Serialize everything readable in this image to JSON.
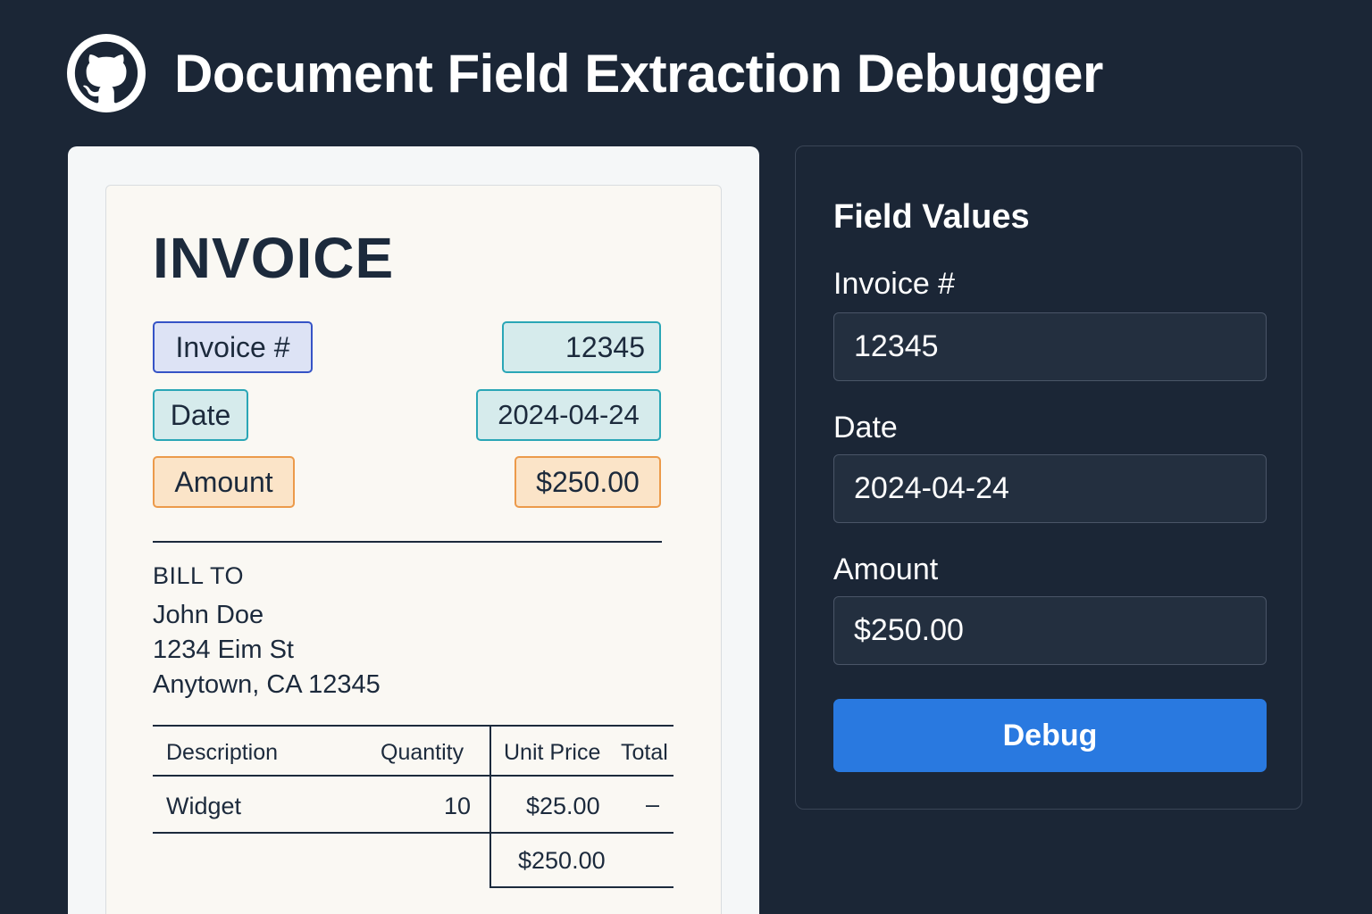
{
  "app": {
    "title": "Document Field Extraction Debugger",
    "logo_icon": "github-icon"
  },
  "document": {
    "title": "INVOICE",
    "fields": {
      "invoice_label": "Invoice #",
      "invoice_value": "12345",
      "date_label": "Date",
      "date_value": "2024-04-24",
      "amount_label": "Amount",
      "amount_value": "$250.00"
    },
    "bill_to": {
      "heading": "BILL TO",
      "name": "John Doe",
      "street": "1234 Eim St",
      "city": "Anytown, CA 12345"
    },
    "table": {
      "headers": [
        "Description",
        "Quantity",
        "Unit Price",
        "Total"
      ],
      "rows": [
        [
          "Widget",
          "10",
          "$25.00",
          "–"
        ]
      ],
      "total": "$250.00"
    }
  },
  "panel": {
    "title": "Field Values",
    "fields": [
      {
        "label": "Invoice #",
        "value": "12345"
      },
      {
        "label": "Date",
        "value": "2024-04-24"
      },
      {
        "label": "Amount",
        "value": "$250.00"
      }
    ],
    "button_label": "Debug"
  },
  "colors": {
    "background": "#1b2636",
    "accent": "#2979e0",
    "chip_blue": "#3553c6",
    "chip_teal": "#2aa6b6",
    "chip_orange": "#ec9a4a"
  }
}
